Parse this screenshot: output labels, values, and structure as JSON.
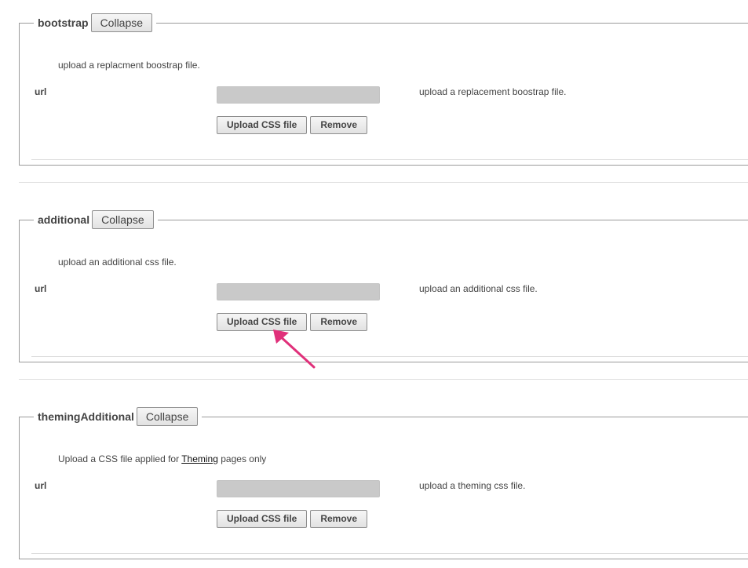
{
  "sections": [
    {
      "title": "bootstrap",
      "collapse_label": "Collapse",
      "description": "upload a replacment boostrap file.",
      "field_label": "url",
      "input_value": "",
      "help_text": "upload a replacement boostrap file.",
      "upload_label": "Upload CSS file",
      "remove_label": "Remove"
    },
    {
      "title": "additional",
      "collapse_label": "Collapse",
      "description": "upload an additional css file.",
      "field_label": "url",
      "input_value": "",
      "help_text": "upload an additional css file.",
      "upload_label": "Upload CSS file",
      "remove_label": "Remove"
    },
    {
      "title": "themingAdditional",
      "collapse_label": "Collapse",
      "description_before": "Upload a CSS file applied for",
      "description_link": "Theming",
      "description_after": "pages only",
      "field_label": "url",
      "input_value": "",
      "help_text": "upload a theming css file.",
      "upload_label": "Upload CSS file",
      "remove_label": "Remove"
    }
  ],
  "annotation": {
    "arrow_color": "#e0307a",
    "icon": "pointer-arrow-icon"
  }
}
